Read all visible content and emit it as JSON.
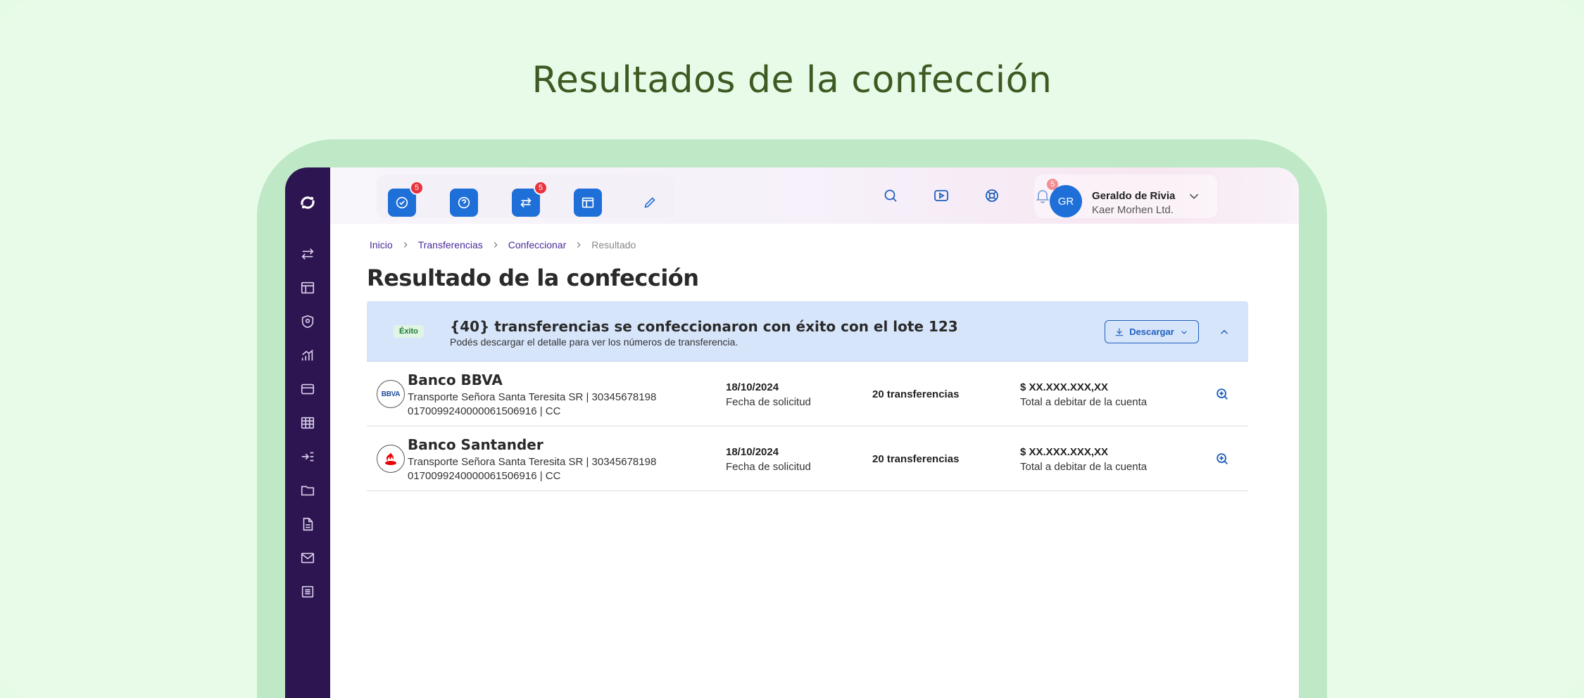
{
  "hero": {
    "title": "Resultados de la confección"
  },
  "quick_actions": {
    "tasks_badge": "5",
    "transfers_badge": "5"
  },
  "top_icons": {
    "notifications_badge": "5"
  },
  "user": {
    "initials": "GR",
    "name": "Geraldo de Rivia",
    "company": "Kaer Morhen Ltd."
  },
  "breadcrumb": {
    "items": [
      "Inicio",
      "Transferencias",
      "Confeccionar",
      "Resultado"
    ]
  },
  "page": {
    "title": "Resultado de la confección"
  },
  "banner": {
    "status": "Éxito",
    "title": "{40} transferencias se confeccionaron con éxito con el lote 123",
    "subtitle": "Podés descargar el detalle para ver los números de transferencia.",
    "download_label": "Descargar"
  },
  "rows": [
    {
      "bank": "Banco BBVA",
      "logo_text": "BBVA",
      "line1": "Transporte Señora Santa Teresita SR | 30345678198",
      "line2": "0170099240000061506916 | CC",
      "date": "18/10/2024",
      "date_label": "Fecha de solicitud",
      "count": "20 transferencias",
      "amount": "$ XX.XXX.XXX,XX",
      "amount_label": "Total a debitar de la cuenta"
    },
    {
      "bank": "Banco Santander",
      "logo_text": "",
      "line1": "Transporte Señora Santa Teresita SR | 30345678198",
      "line2": "0170099240000061506916 | CC",
      "date": "18/10/2024",
      "date_label": "Fecha de solicitud",
      "count": "20 transferencias",
      "amount": "$ XX.XXX.XXX,XX",
      "amount_label": "Total a debitar de la cuenta"
    }
  ],
  "colors": {
    "accent": "#1f6fd8",
    "sidebar": "#2d1552",
    "banner": "#d7e5fb",
    "badge": "#e8323c",
    "hero_text": "#3d5a22",
    "santander_red": "#ec0000"
  }
}
